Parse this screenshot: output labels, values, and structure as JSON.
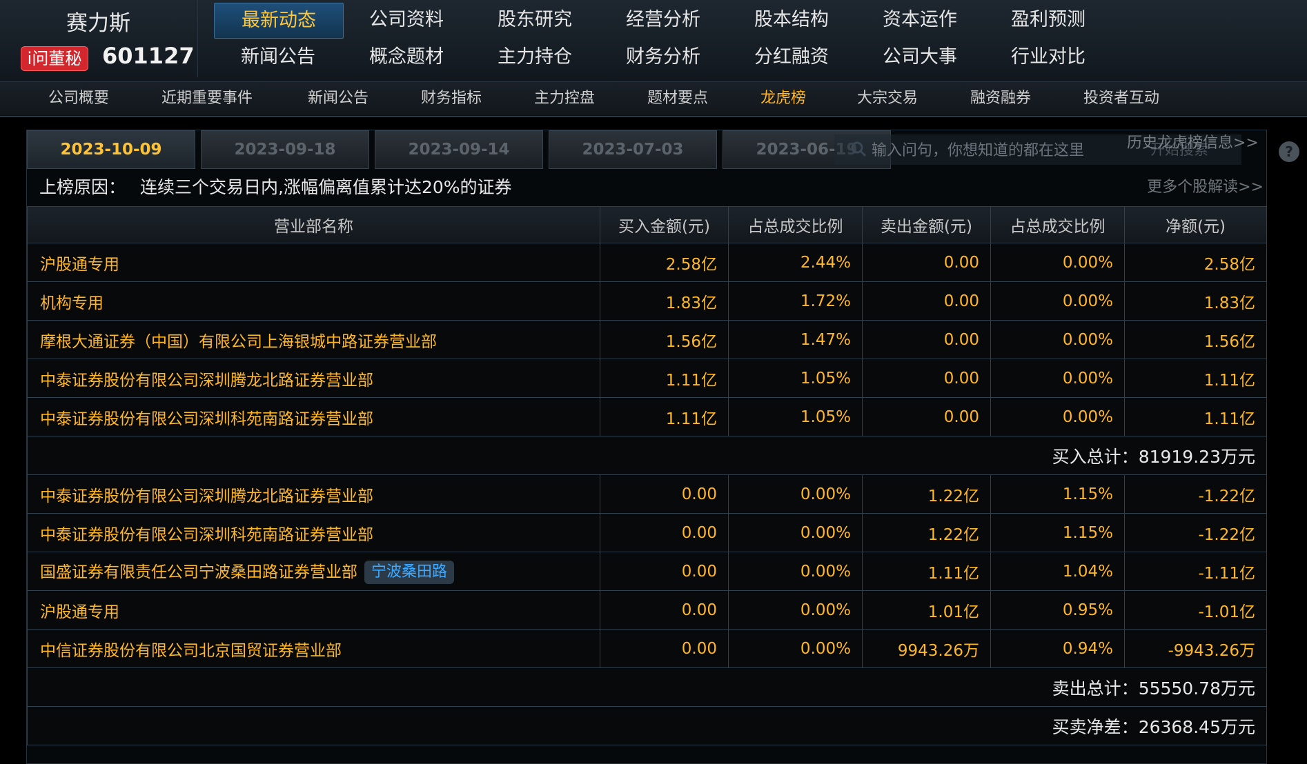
{
  "brand": {
    "name": "赛力斯",
    "badge": "i问董秘",
    "code": "601127"
  },
  "main_nav": [
    {
      "label": "最新动态",
      "active": true
    },
    {
      "label": "公司资料"
    },
    {
      "label": "股东研究"
    },
    {
      "label": "经营分析"
    },
    {
      "label": "股本结构"
    },
    {
      "label": "资本运作"
    },
    {
      "label": "盈利预测"
    },
    {
      "label": "新闻公告"
    },
    {
      "label": "概念题材"
    },
    {
      "label": "主力持仓"
    },
    {
      "label": "财务分析"
    },
    {
      "label": "分红融资"
    },
    {
      "label": "公司大事"
    },
    {
      "label": "行业对比"
    }
  ],
  "sub_nav": [
    {
      "label": "公司概要"
    },
    {
      "label": "近期重要事件"
    },
    {
      "label": "新闻公告"
    },
    {
      "label": "财务指标"
    },
    {
      "label": "主力控盘"
    },
    {
      "label": "题材要点"
    },
    {
      "label": "龙虎榜",
      "active": true
    },
    {
      "label": "大宗交易"
    },
    {
      "label": "融资融券"
    },
    {
      "label": "投资者互动"
    }
  ],
  "date_tabs": [
    "2023-10-09",
    "2023-09-18",
    "2023-09-14",
    "2023-07-03",
    "2023-06-19"
  ],
  "search": {
    "placeholder": "输入问句，你想知道的都在这里",
    "button": "开始搜索"
  },
  "history_link": "历史龙虎榜信息>>",
  "help_icon": "?",
  "reason": {
    "label": "上榜原因：",
    "text": "连续三个交易日内,涨幅偏离值累计达20%的证券",
    "more": "更多个股解读>>"
  },
  "table": {
    "headers": [
      "营业部名称",
      "买入金额(元)",
      "占总成交比例",
      "卖出金额(元)",
      "占总成交比例",
      "净额(元)"
    ],
    "buy_rows": [
      {
        "name": "沪股通专用",
        "buy": "2.58",
        "buy_unit": "亿",
        "buy_pct": "2.44%",
        "sell": "0.00",
        "sell_unit": "",
        "sell_pct": "0.00%",
        "net": "2.58",
        "net_unit": "亿"
      },
      {
        "name": "机构专用",
        "buy": "1.83",
        "buy_unit": "亿",
        "buy_pct": "1.72%",
        "sell": "0.00",
        "sell_unit": "",
        "sell_pct": "0.00%",
        "net": "1.83",
        "net_unit": "亿"
      },
      {
        "name": "摩根大通证券（中国）有限公司上海银城中路证券营业部",
        "buy": "1.56",
        "buy_unit": "亿",
        "buy_pct": "1.47%",
        "sell": "0.00",
        "sell_unit": "",
        "sell_pct": "0.00%",
        "net": "1.56",
        "net_unit": "亿"
      },
      {
        "name": "中泰证券股份有限公司深圳腾龙北路证券营业部",
        "buy": "1.11",
        "buy_unit": "亿",
        "buy_pct": "1.05%",
        "sell": "0.00",
        "sell_unit": "",
        "sell_pct": "0.00%",
        "net": "1.11",
        "net_unit": "亿"
      },
      {
        "name": "中泰证券股份有限公司深圳科苑南路证券营业部",
        "buy": "1.11",
        "buy_unit": "亿",
        "buy_pct": "1.05%",
        "sell": "0.00",
        "sell_unit": "",
        "sell_pct": "0.00%",
        "net": "1.11",
        "net_unit": "亿"
      }
    ],
    "buy_total": {
      "label": "买入总计：",
      "value": "81919.23",
      "unit": "万元"
    },
    "sell_rows": [
      {
        "name": "中泰证券股份有限公司深圳腾龙北路证券营业部",
        "buy": "0.00",
        "buy_unit": "",
        "buy_pct": "0.00%",
        "sell": "1.22",
        "sell_unit": "亿",
        "sell_pct": "1.15%",
        "net": "-1.22",
        "net_unit": "亿"
      },
      {
        "name": "中泰证券股份有限公司深圳科苑南路证券营业部",
        "buy": "0.00",
        "buy_unit": "",
        "buy_pct": "0.00%",
        "sell": "1.22",
        "sell_unit": "亿",
        "sell_pct": "1.15%",
        "net": "-1.22",
        "net_unit": "亿"
      },
      {
        "name": "国盛证券有限责任公司宁波桑田路证券营业部",
        "tag": "宁波桑田路",
        "buy": "0.00",
        "buy_unit": "",
        "buy_pct": "0.00%",
        "sell": "1.11",
        "sell_unit": "亿",
        "sell_pct": "1.04%",
        "net": "-1.11",
        "net_unit": "亿"
      },
      {
        "name": "沪股通专用",
        "buy": "0.00",
        "buy_unit": "",
        "buy_pct": "0.00%",
        "sell": "1.01",
        "sell_unit": "亿",
        "sell_pct": "0.95%",
        "net": "-1.01",
        "net_unit": "亿"
      },
      {
        "name": "中信证券股份有限公司北京国贸证券营业部",
        "buy": "0.00",
        "buy_unit": "",
        "buy_pct": "0.00%",
        "sell": "9943.26",
        "sell_unit": "万",
        "sell_pct": "0.94%",
        "net": "-9943.26",
        "net_unit": "万"
      }
    ],
    "sell_total": {
      "label": "卖出总计：",
      "value": "55550.78",
      "unit": "万元"
    },
    "net_total": {
      "label": "买卖净差：",
      "value": "26368.45",
      "unit": "万元"
    }
  }
}
